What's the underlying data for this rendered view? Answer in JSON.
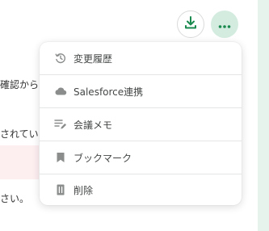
{
  "background_text": {
    "line1": "確認から",
    "line2": "されてい",
    "line3": "さい。"
  },
  "toolbar": {
    "download_icon": "download-icon",
    "more_icon": "more-horizontal-icon"
  },
  "menu": {
    "items": [
      {
        "label": "変更履歴",
        "icon": "history-icon"
      },
      {
        "label": "Salesforce連携",
        "icon": "cloud-icon"
      },
      {
        "label": "会議メモ",
        "icon": "edit-note-icon"
      },
      {
        "label": "ブックマーク",
        "icon": "bookmark-icon"
      },
      {
        "label": "削除",
        "icon": "trash-icon"
      }
    ]
  },
  "colors": {
    "accent": "#1a8a4f",
    "accent_light": "#d4ece0",
    "icon_gray": "#8a8d8c",
    "text": "#444746"
  }
}
